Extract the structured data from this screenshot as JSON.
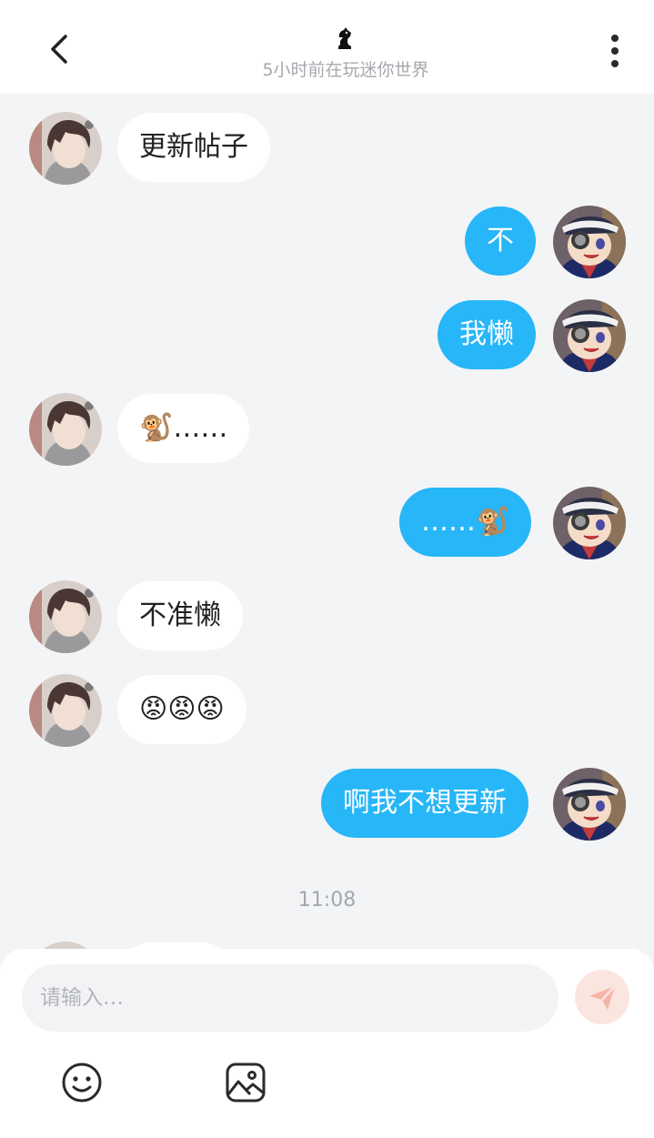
{
  "header": {
    "title_icon": "chess-knight-icon",
    "status": "5小时前在玩迷你世界"
  },
  "messages": [
    {
      "side": "in",
      "text": "更新帖子"
    },
    {
      "side": "out",
      "text": "不"
    },
    {
      "side": "out",
      "text": "我懒"
    },
    {
      "side": "in",
      "text": "🐒……"
    },
    {
      "side": "out",
      "text": "……🐒"
    },
    {
      "side": "in",
      "text": "不准懒"
    },
    {
      "side": "in",
      "text": "😡😡😡"
    },
    {
      "side": "out",
      "text": "啊我不想更新"
    }
  ],
  "time_divider": "11:08",
  "composer": {
    "placeholder": "请输入…",
    "send_icon": "send-icon",
    "emoji_icon": "emoji-icon",
    "image_icon": "image-icon"
  },
  "colors": {
    "outgoing_bubble": "#27b6f8",
    "incoming_bubble": "#ffffff",
    "background": "#f3f4f6",
    "send_button": "#fbe5df",
    "send_arrow": "#f5b4a7"
  }
}
